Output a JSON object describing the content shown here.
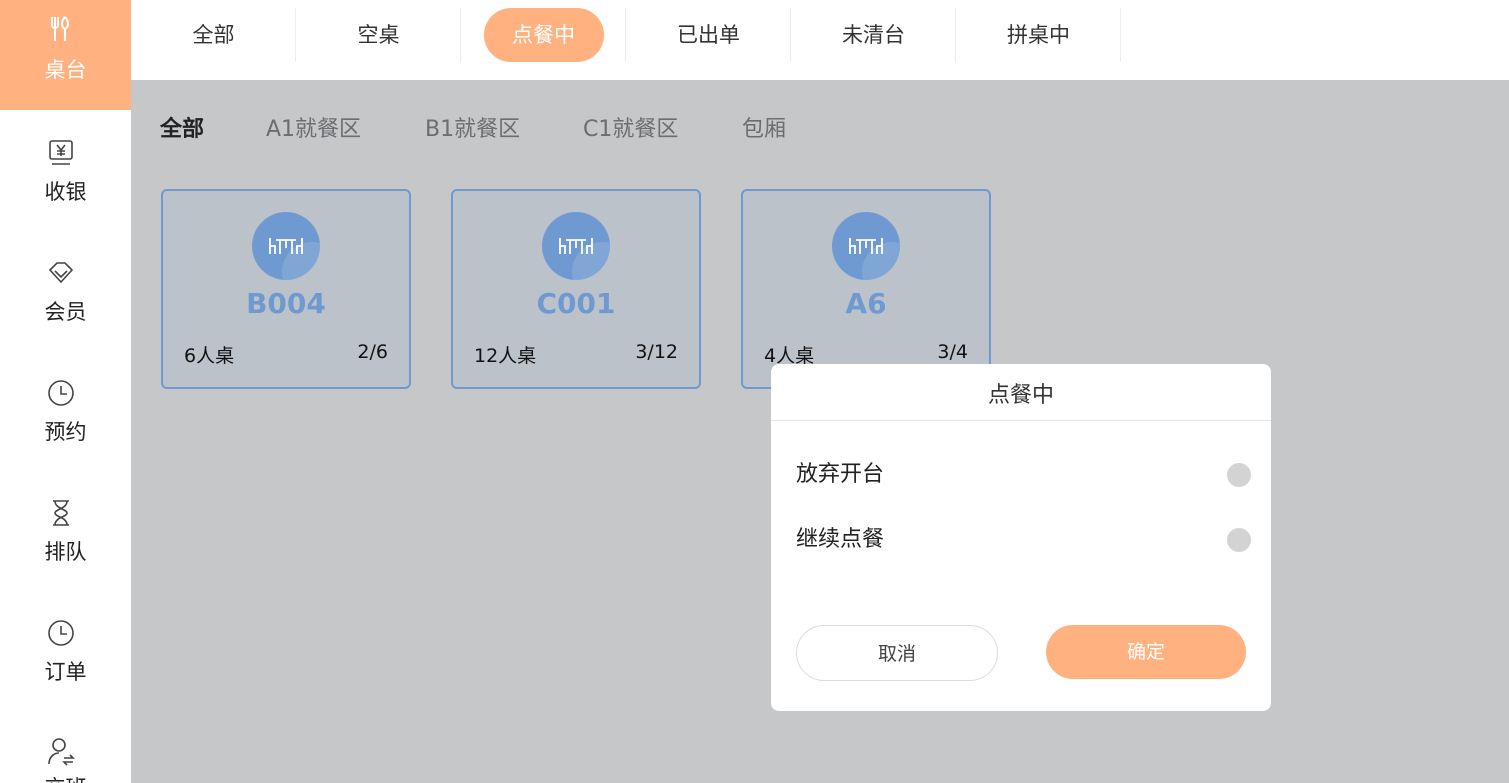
{
  "sidebar": {
    "items": [
      {
        "label": "桌台",
        "icon": "fork-knife-icon",
        "active": true
      },
      {
        "label": "收银",
        "icon": "cashier-icon"
      },
      {
        "label": "会员",
        "icon": "diamond-icon"
      },
      {
        "label": "预约",
        "icon": "clock-icon"
      },
      {
        "label": "排队",
        "icon": "hourglass-icon"
      },
      {
        "label": "订单",
        "icon": "clock-icon"
      },
      {
        "label": "交班",
        "icon": "user-swap-icon"
      }
    ]
  },
  "tabs": [
    {
      "label": "全部"
    },
    {
      "label": "空桌"
    },
    {
      "label": "点餐中",
      "active": true
    },
    {
      "label": "已出单"
    },
    {
      "label": "未清台"
    },
    {
      "label": "拼桌中"
    }
  ],
  "areas": [
    {
      "label": "全部",
      "active": true
    },
    {
      "label": "A1就餐区"
    },
    {
      "label": "B1就餐区"
    },
    {
      "label": "C1就餐区"
    },
    {
      "label": "包厢"
    }
  ],
  "tables": [
    {
      "code": "B004",
      "capacity": "6人桌",
      "occupancy": "2/6"
    },
    {
      "code": "C001",
      "capacity": "12人桌",
      "occupancy": "3/12"
    },
    {
      "code": "A6",
      "capacity": "4人桌",
      "occupancy": "3/4"
    }
  ],
  "modal": {
    "title": "点餐中",
    "options": [
      {
        "label": "放弃开台"
      },
      {
        "label": "继续点餐"
      }
    ],
    "cancel_label": "取消",
    "confirm_label": "确定"
  },
  "colors": {
    "accent": "#ffb180",
    "card_blue": "#6f9ad1",
    "overlay": "#c6c7c9"
  }
}
